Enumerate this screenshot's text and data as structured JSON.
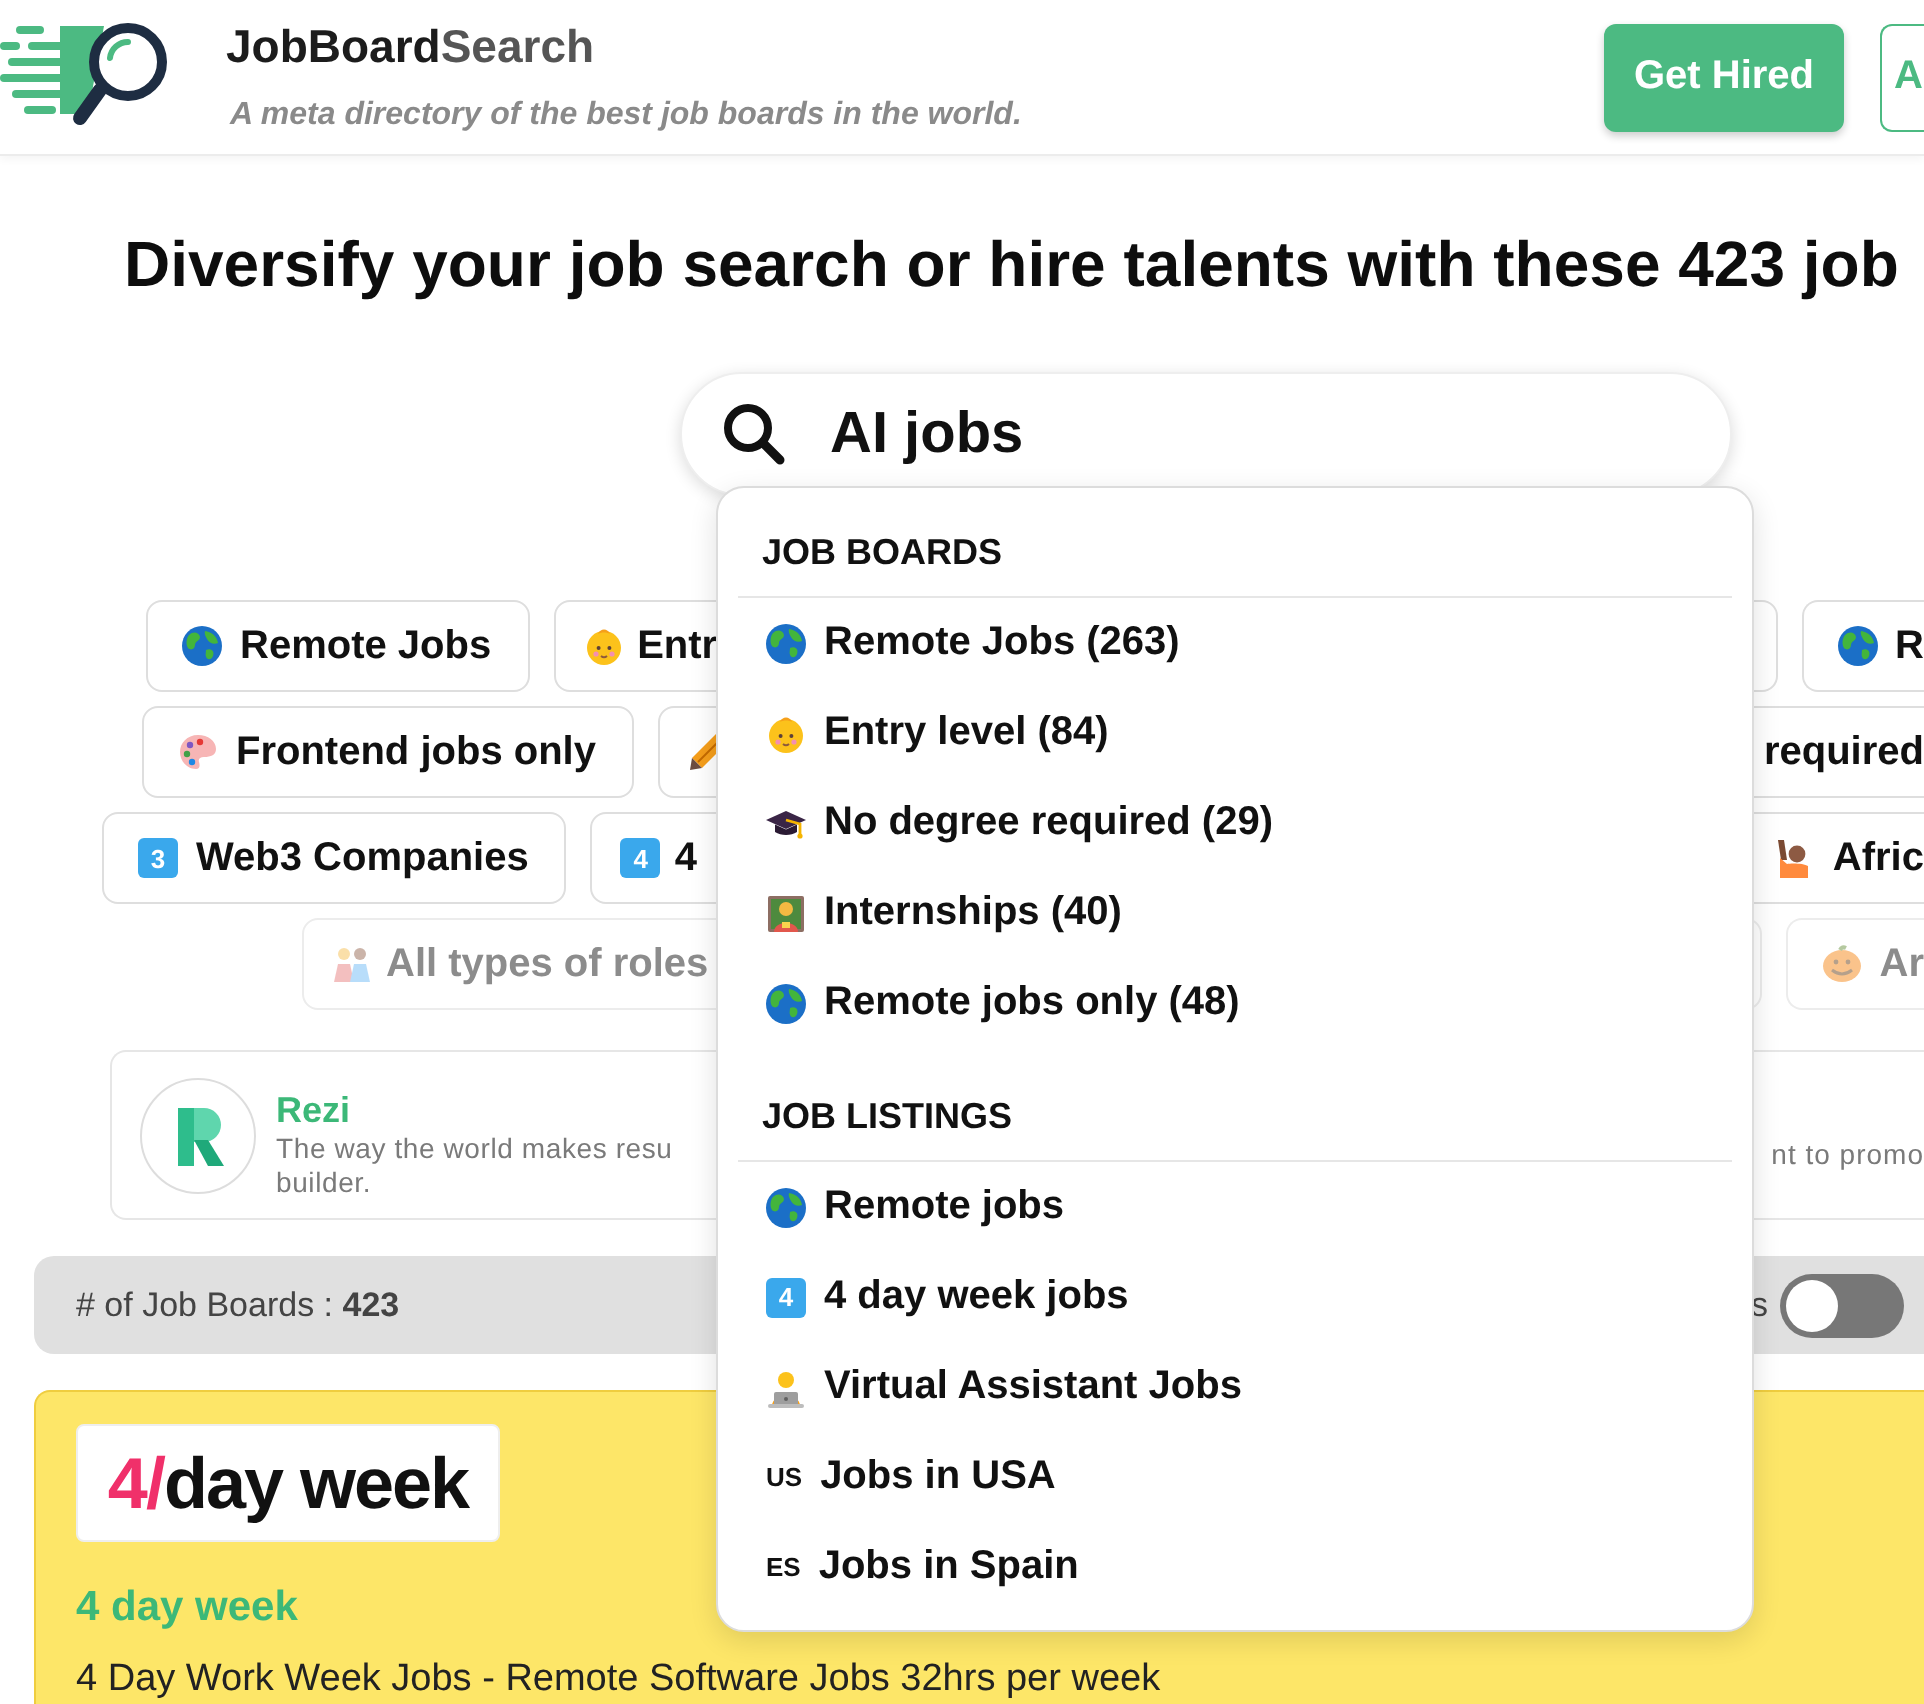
{
  "header": {
    "brand": {
      "dark": "JobBoard",
      "light": "Search"
    },
    "tagline": "A meta directory of the best job boards in the world.",
    "buttons": [
      {
        "label": "Get Hired",
        "kind": "filled"
      },
      {
        "label": "A",
        "kind": "outline"
      }
    ]
  },
  "headline": "Diversify your job search or hire talents with these 423 job",
  "search": {
    "value": "AI jobs"
  },
  "chip_rows": [
    {
      "faded": false,
      "left": [
        {
          "label": "Remote Jobs",
          "kind": "globe"
        },
        {
          "label": "Entr",
          "kind": "baby"
        }
      ],
      "right": [
        {
          "kind": "blank"
        },
        {
          "label": "R",
          "kind": "globe"
        }
      ]
    },
    {
      "faded": false,
      "left": [
        {
          "label": "Frontend jobs only",
          "kind": "palette"
        },
        {
          "kind": "pencil"
        }
      ],
      "right": [
        {
          "label": "required",
          "kind": "blank"
        }
      ]
    },
    {
      "faded": false,
      "left": [
        {
          "label": "Web3 Companies",
          "kind": "keycap",
          "keycap": "3"
        },
        {
          "label": "4",
          "kind": "keycap",
          "keycap": "4"
        }
      ],
      "right": [
        {
          "label": "Afric",
          "kind": "raising-hand"
        }
      ]
    },
    {
      "faded": true,
      "left": [
        {
          "label": "All types of roles",
          "kind": "people"
        }
      ],
      "right": [
        {
          "kind": "blank"
        },
        {
          "label": "Ar",
          "kind": "pumpkin"
        }
      ]
    }
  ],
  "promo": {
    "name": "Rezi",
    "description": [
      "The way the world makes resu",
      "builder."
    ],
    "fragment": "nt to promo"
  },
  "status_bar": {
    "text": "# of Job Boards : **423**",
    "toggle": {
      "label": "s",
      "on": false
    }
  },
  "listing": {
    "logo": {
      "accent": "4/",
      "text": "day week"
    },
    "title": "4 day week",
    "description": "4 Day Work Week Jobs - Remote Software Jobs 32hrs per week"
  },
  "dropdown": {
    "sections": [
      {
        "title": "JOB BOARDS",
        "items": [
          {
            "label": "Remote Jobs (263)",
            "kind": "globe"
          },
          {
            "label": "Entry level (84)",
            "kind": "baby"
          },
          {
            "label": "No degree required (29)",
            "kind": "graduation-cap"
          },
          {
            "label": "Internships (40)",
            "kind": "teacher"
          },
          {
            "label": "Remote jobs only (48)",
            "kind": "globe"
          }
        ]
      },
      {
        "title": "JOB LISTINGS",
        "items": [
          {
            "label": "Remote jobs",
            "kind": "globe"
          },
          {
            "label": "4 day week jobs",
            "kind": "keycap",
            "keycap": "4"
          },
          {
            "label": "Virtual Assistant Jobs",
            "kind": "technologist"
          },
          {
            "label": "Jobs in USA",
            "kind": "flag",
            "flag": "US"
          },
          {
            "label": "Jobs in Spain",
            "kind": "flag",
            "flag": "ES"
          }
        ]
      }
    ]
  }
}
